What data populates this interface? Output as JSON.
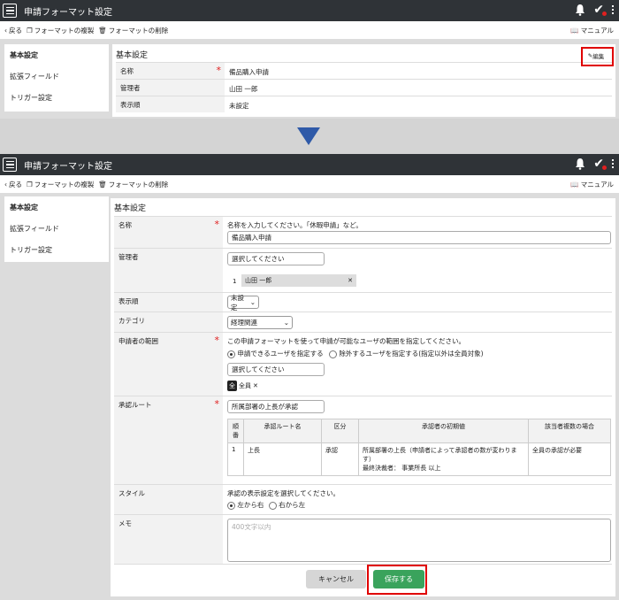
{
  "top_screen": {
    "app_title": "申請フォーマット設定",
    "toolbar": {
      "back": "戻る",
      "copy": "フォーマットの複製",
      "delete": "フォーマットの削除",
      "manual": "マニュアル"
    },
    "sidenav": [
      "基本設定",
      "拡張フィールド",
      "トリガー設定"
    ],
    "panel_title": "基本設定",
    "edit_button": "編集",
    "rows": [
      {
        "label": "名称",
        "value": "備品購入申請",
        "required": "*"
      },
      {
        "label": "管理者",
        "value": "山田 一郎"
      },
      {
        "label": "表示順",
        "value": "未設定"
      }
    ]
  },
  "bottom_screen": {
    "app_title": "申請フォーマット設定",
    "toolbar": {
      "back": "戻る",
      "copy": "フォーマットの複製",
      "delete": "フォーマットの削除",
      "manual": "マニュアル"
    },
    "sidenav": [
      "基本設定",
      "拡張フィールド",
      "トリガー設定"
    ],
    "panel_title": "基本設定",
    "name": {
      "label": "名称",
      "required": "*",
      "hint": "名称を入力してください。「休暇申請」など。",
      "value": "備品購入申請"
    },
    "manager": {
      "label": "管理者",
      "placeholder": "選択してください",
      "item_no": "1",
      "item_name": "山田 一郎"
    },
    "order": {
      "label": "表示順",
      "value": "未設定"
    },
    "category": {
      "label": "カテゴリ",
      "value": "経理関連"
    },
    "applicant": {
      "label": "申請者の範囲",
      "required": "*",
      "hint": "この申請フォーマットを使って申請が可能なユーザの範囲を指定してください。",
      "radio1": "申請できるユーザを指定する",
      "radio2": "除外するユーザを指定する(指定以外は全員対象)",
      "placeholder": "選択してください",
      "tag_icon": "全",
      "tag_label": "全員"
    },
    "approval": {
      "label": "承認ルート",
      "required": "*",
      "value": "所属部署の上長が承認",
      "headers": [
        "順番",
        "承認ルート名",
        "区分",
        "承認者の初期値",
        "該当者複数の場合"
      ],
      "rows": [
        {
          "no": "1",
          "name": "上長",
          "type": "承認",
          "initial_1": "所属部署の上長（申請者によって承認者の数が変わります）",
          "initial_2": "最終決裁者： 事業所長 以上",
          "multi": "全員の承認が必要"
        }
      ]
    },
    "style": {
      "label": "スタイル",
      "hint": "承認の表示設定を選択してください。",
      "radio1": "左から右",
      "radio2": "右から左"
    },
    "memo": {
      "label": "メモ",
      "placeholder": "400文字以内"
    },
    "cancel_button": "キャンセル",
    "save_button": "保存する"
  },
  "colors": {
    "titlebar": "#2f3337",
    "accent_save": "#3aa35c",
    "highlight": "#e00000",
    "arrow": "#2f5aa8"
  }
}
